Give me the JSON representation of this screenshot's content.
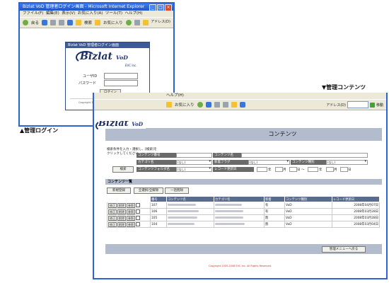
{
  "login_window": {
    "title": "Bizlat VoD 管理者ログイン画面 - Microsoft Internet Explorer",
    "menu": [
      "ファイル(F)",
      "編集(E)",
      "表示(V)",
      "お気に入り(A)",
      "ツール(T)",
      "ヘルプ(H)"
    ],
    "toolbar": {
      "back_label": "戻る",
      "search_label": "検索",
      "favorites_label": "お気に入り",
      "address_label": "アドレス(D)"
    },
    "panel_header": "Bizlat VoD 管理者ログイン画面",
    "logo_text": "Bizlat",
    "logo_sub": "VoD",
    "evc_text": "EVC Inc.",
    "userid_label": "ユーザID",
    "password_label": "パスワード",
    "login_button": "ログイン",
    "copyright": "Copyright 2005-2008 EVC Inc. All Rights Reserved."
  },
  "captions": {
    "login": "▲管理ログイン",
    "contents": "▼管理コンテンツ"
  },
  "contents_window": {
    "menu_help": "ヘルプ(H)",
    "toolbar": {
      "favorites_label": "お気に入り",
      "address_label": "アドレス(D)",
      "go_label": "移動"
    },
    "logo_text": "Bizlat",
    "logo_sub": "VoD",
    "page_title": "コンテンツ",
    "search_help": "検索条件を入力・選択し、[検索]をクリックしてください。",
    "search_button": "検索",
    "fields": {
      "content_no": "コンテンツ番号",
      "content_name": "コンテンツ名",
      "category": "カテゴリ名",
      "new_flag": "新着フラグ",
      "content_type": "コンテンツ種別",
      "folder": "コンテンツフォルダ名",
      "updated": "レコード更新日"
    },
    "select_default": "(なし)",
    "date_units": {
      "year": "年",
      "month": "月",
      "day": "日",
      "range": "～"
    },
    "list_title": "コンテンツ一覧",
    "list_buttons": [
      "新規登録",
      "全選択/全解除",
      "一括削除"
    ],
    "columns": [
      "",
      "番号",
      "コンテンツ名",
      "カテゴリ名",
      "新着",
      "コンテンツ種別",
      "レコード更新日"
    ],
    "row_buttons": [
      "修正",
      "削除",
      "参照"
    ],
    "rows": [
      {
        "id": "107",
        "new": "有",
        "type": "VoD",
        "date": "2008年04月07日"
      },
      {
        "id": "106",
        "new": "有",
        "type": "VoD",
        "date": "2008年03月28日"
      },
      {
        "id": "105",
        "new": "無",
        "type": "VoD",
        "date": "2008年03月28日"
      },
      {
        "id": "104",
        "new": "無",
        "type": "VoD",
        "date": "2008年03月04日"
      }
    ],
    "back_button": "管理メニューへ戻る",
    "footer": "Copyright 2005-2008 EVC Inc. All Rights Reserved."
  },
  "colors": {
    "xp_blue": "#2a63d8",
    "header_band": "#b2bccc",
    "table_head": "#5b6b8c",
    "logo": "#1d2f6b"
  }
}
